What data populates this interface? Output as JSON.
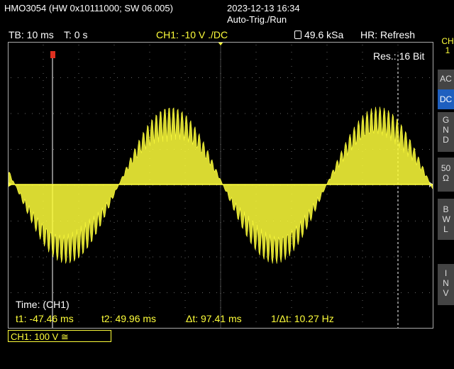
{
  "header": {
    "device": "HMO3054 (HW 0x10111000; SW 06.005)",
    "datetime": "2023-12-13 16:34",
    "trigger_state": "Auto-Trig./Run"
  },
  "statusbar": {
    "timebase": "TB: 10 ms",
    "trigger_time": "T: 0 s",
    "channel_setting": "CH1: -10 V ./DC",
    "sample_rate": "49.6 kSa",
    "hr_mode": "HR: Refresh"
  },
  "screen": {
    "resolution": "Res.: 16 Bit",
    "cursor_title": "Time: (CH1)",
    "t1": "t1: -47.46 ms",
    "t2": "t2: 49.96 ms",
    "dt": "Δt: 97.41 ms",
    "inv_dt": "1/Δt: 10.27 Hz"
  },
  "side_menu": {
    "channel": "CH 1",
    "buttons": [
      {
        "label": "AC",
        "active": false
      },
      {
        "label": "DC",
        "active": true
      },
      {
        "label": "GND",
        "active": false
      },
      {
        "label": "50 Ω",
        "active": false
      },
      {
        "label": "BWL",
        "active": false
      },
      {
        "label": "INV",
        "active": false
      }
    ]
  },
  "bottom": {
    "ch_scale": "CH1: 100 V ≅"
  },
  "colors": {
    "trace": "#ffff3a",
    "grid": "#666666",
    "active_button": "#1e5fbf"
  }
}
